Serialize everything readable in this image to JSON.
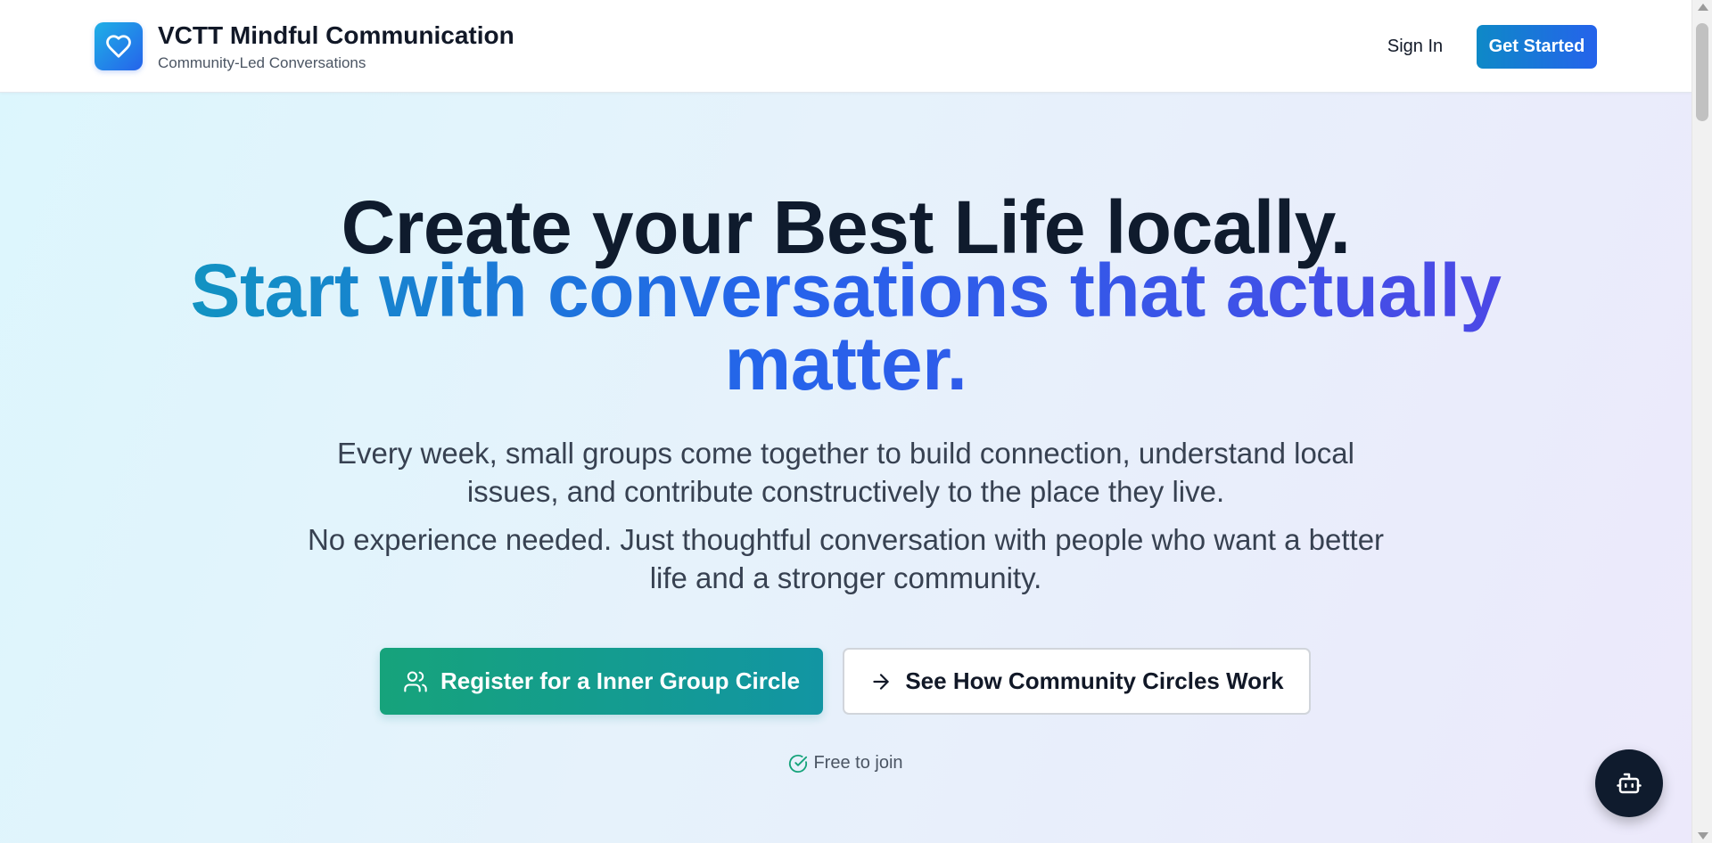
{
  "header": {
    "logo_icon": "heart-icon",
    "brand_title": "VCTT Mindful Communication",
    "brand_subtitle": "Community-Led Conversations",
    "sign_in_label": "Sign In",
    "get_started_label": "Get Started"
  },
  "hero": {
    "headline_line1": "Create your Best Life locally.",
    "headline_line2": "Start with conversations that actually matter.",
    "paragraph1": "Every week, small groups come together to build connection, understand local issues, and contribute constructively to the place they live.",
    "paragraph2": "No experience needed. Just thoughtful conversation with people who want a better life and a stronger community.",
    "register_button": {
      "label": "Register for a Inner Group Circle",
      "icon": "users-icon"
    },
    "see_how_button": {
      "label": "See How Community Circles Work",
      "icon": "arrow-right-icon"
    },
    "free_note": {
      "label": "Free to join",
      "icon": "check-circle-icon"
    }
  },
  "floating": {
    "chatbot_icon": "bot-icon"
  },
  "colors": {
    "primary_blue": "#2563eb",
    "teal": "#0f98bd",
    "green": "#16a37b",
    "indigo": "#4f46e5",
    "dark": "#0f1b2d"
  }
}
